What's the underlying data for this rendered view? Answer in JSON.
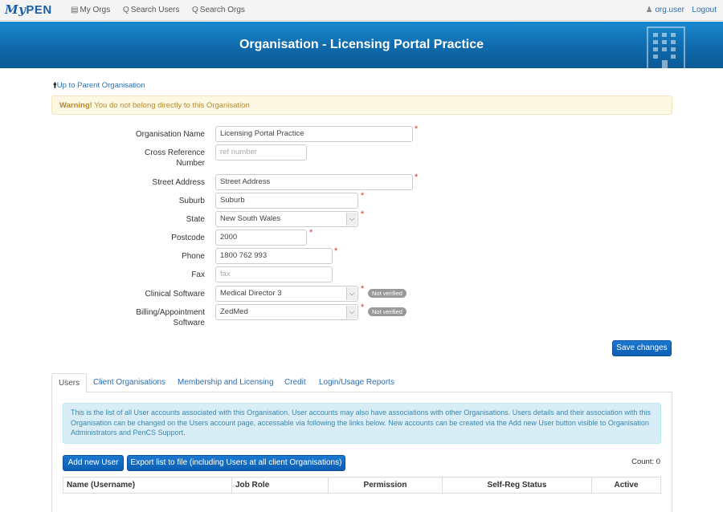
{
  "nav": {
    "logo_my": "My",
    "logo_pen": "PEN",
    "my_orgs": "My Orgs",
    "search_users": "Search Users",
    "search_orgs": "Search Orgs",
    "user": "org.user",
    "logout": "Logout"
  },
  "banner": {
    "title": "Organisation - Licensing Portal Practice"
  },
  "parent_link": "Up to Parent Organisation",
  "warning": {
    "strong": "Warning!",
    "text": " You do not belong directly to this Organisation"
  },
  "form": {
    "org_name": {
      "label": "Organisation Name",
      "value": "Licensing Portal Practice"
    },
    "cross_ref": {
      "label_1": "Cross Reference",
      "label_2": "Number",
      "placeholder": "ref number"
    },
    "street": {
      "label": "Street Address",
      "value": "Street Address"
    },
    "suburb": {
      "label": "Suburb",
      "value": "Suburb"
    },
    "state": {
      "label": "State",
      "value": "New South Wales"
    },
    "postcode": {
      "label": "Postcode",
      "value": "2000"
    },
    "phone": {
      "label": "Phone",
      "value": "1800 762 993"
    },
    "fax": {
      "label": "Fax",
      "placeholder": "fax"
    },
    "clinical": {
      "label": "Clinical Software",
      "value": "Medical Director 3",
      "badge": "Not verified"
    },
    "billing": {
      "label_1": "Billing/Appointment",
      "label_2": "Software",
      "value": "ZedMed",
      "badge": "Not verified"
    },
    "required_mark": "*",
    "save": "Save changes"
  },
  "tabs": [
    "Users",
    "Client Organisations",
    "Membership and Licensing",
    "Credit",
    "Login/Usage Reports"
  ],
  "users": {
    "info": "This is the list of all User accounts associated with this Organisation. User accounts may also have associations with other Organisations. Users details and their association with this Organisation can be changed on the Users account page, accessable via following the links below. New accounts can be created via the Add new User button visible to Organisation Administrators and PenCS Support.",
    "add_button": "Add new User",
    "export_button": "Export list to file (including Users at all client Organisations)",
    "count": "Count: 0",
    "columns": [
      "Name (Username)",
      "Job Role",
      "Permission",
      "Self-Reg Status",
      "Active"
    ]
  },
  "colors": {
    "banner": "#0f6aab",
    "link": "#2a6fb5",
    "warning_bg": "#fcf8e3",
    "info_bg": "#d9edf7",
    "required": "#dd3333"
  },
  "icons": [
    "my-orgs-icon",
    "search-icon",
    "user-icon",
    "up-arrow-icon",
    "building-icon",
    "chevron-down-icon"
  ]
}
